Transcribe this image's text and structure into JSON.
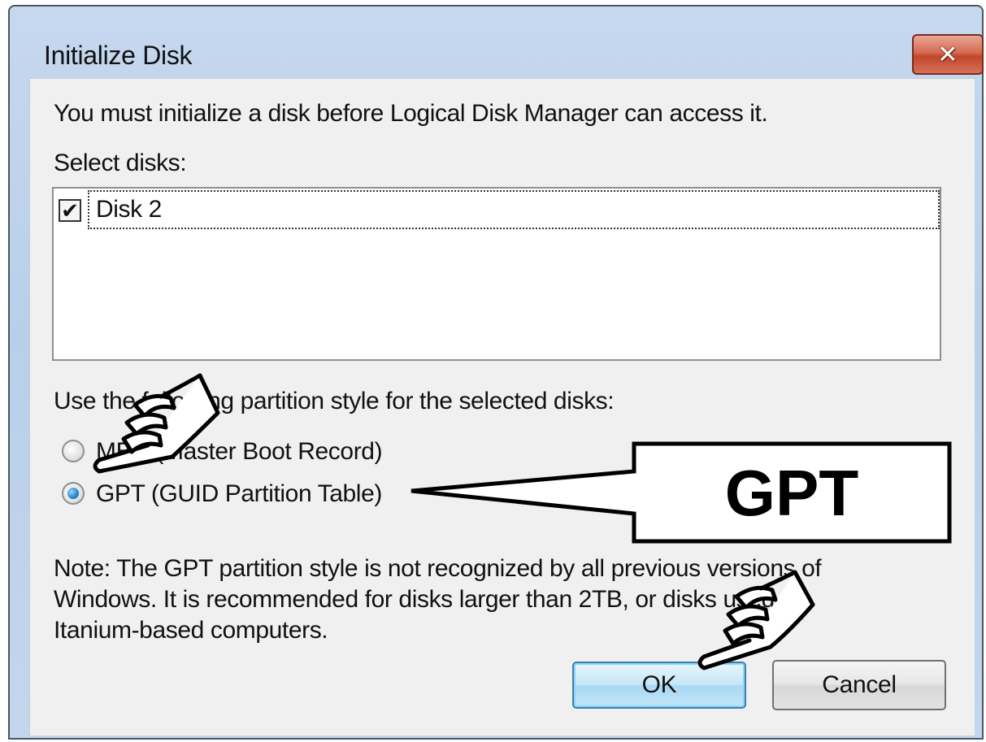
{
  "window": {
    "title": "Initialize Disk",
    "close_glyph": "✕"
  },
  "dialog": {
    "intro": "You must initialize a disk before Logical Disk Manager can access it.",
    "select_label": "Select disks:",
    "disks": [
      {
        "label": "Disk 2",
        "checked": true
      }
    ],
    "partition_label": "Use the following partition style for the selected disks:",
    "options": [
      {
        "label": "MBR (Master Boot Record)",
        "checked": false
      },
      {
        "label": "GPT (GUID Partition Table)",
        "checked": true
      }
    ],
    "note_lines": [
      "Note: The GPT partition style is not recognized by all previous versions of",
      "Windows. It is recommended for disks larger than 2TB, or disks used on",
      "Itanium-based computers."
    ],
    "ok_label": "OK",
    "cancel_label": "Cancel"
  },
  "annotations": {
    "callout_text": "GPT",
    "pointer_icon": "pointing-hand-icon"
  },
  "colors": {
    "title_bar": "#c5d8ee",
    "content_bg": "#f0f0f0",
    "close_button": "#c24529",
    "ok_button_border": "#3c7fb1"
  }
}
